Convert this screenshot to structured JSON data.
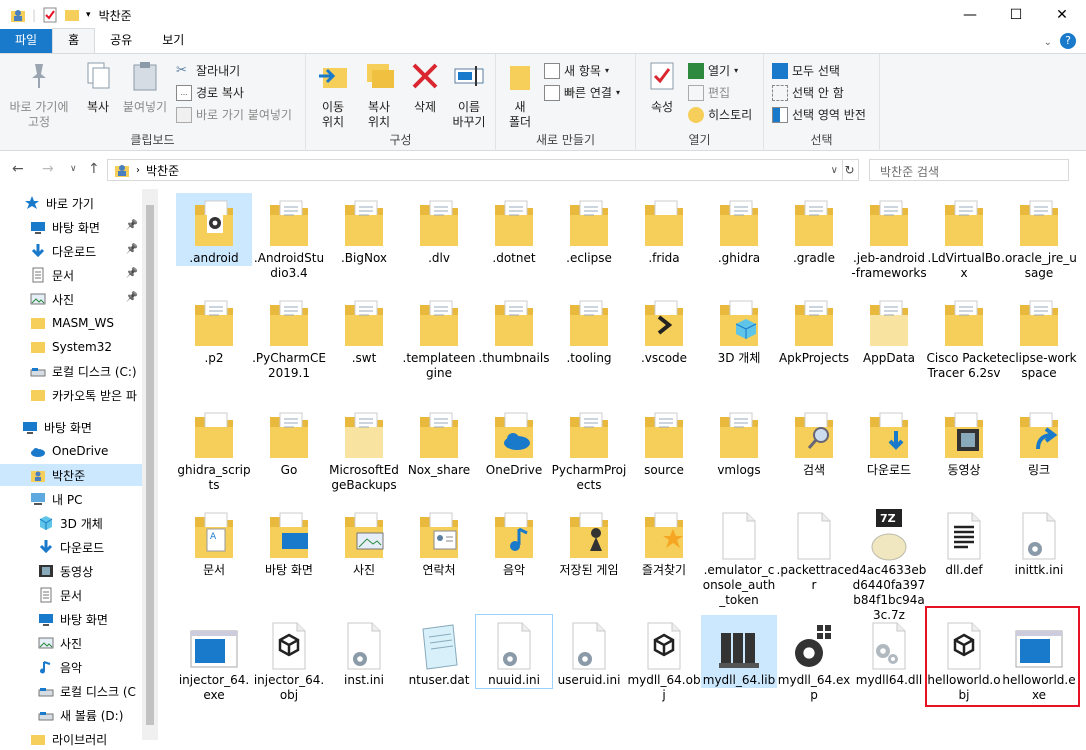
{
  "window": {
    "title": "박찬준",
    "minimize_glyph": "—",
    "maximize_glyph": "☐",
    "close_glyph": "✕"
  },
  "ribbon_tabs": [
    "파일",
    "홈",
    "공유",
    "보기"
  ],
  "ribbon": {
    "clipboard": {
      "label": "클립보드",
      "pin": "바로 가기에\n고정",
      "copy": "복사",
      "paste": "붙여넣기",
      "cut": "잘라내기",
      "copy_path": "경로 복사",
      "paste_shortcut": "바로 가기 붙여넣기"
    },
    "organize": {
      "label": "구성",
      "move_to": "이동\n위치",
      "copy_to": "복사\n위치",
      "delete": "삭제",
      "rename": "이름\n바꾸기"
    },
    "new": {
      "label": "새로 만들기",
      "new_folder": "새\n폴더",
      "new_item": "새 항목",
      "easy_access": "빠른 연결"
    },
    "open": {
      "label": "열기",
      "properties": "속성",
      "open": "열기",
      "edit": "편집",
      "history": "히스토리"
    },
    "select": {
      "label": "선택",
      "select_all": "모두 선택",
      "select_none": "선택 안 함",
      "invert": "선택 영역 반전"
    }
  },
  "address": {
    "path": "박찬준",
    "search_placeholder": "박찬준 검색"
  },
  "nav_pane": [
    {
      "label": "바로 가기",
      "icon": "star-icon",
      "pinned": false
    },
    {
      "label": "바탕 화면",
      "icon": "desktop-icon",
      "pinned": true
    },
    {
      "label": "다운로드",
      "icon": "download-icon",
      "pinned": true
    },
    {
      "label": "문서",
      "icon": "document-icon",
      "pinned": true
    },
    {
      "label": "사진",
      "icon": "picture-icon",
      "pinned": true
    },
    {
      "label": "MASM_WS",
      "icon": "folder-icon",
      "pinned": false
    },
    {
      "label": "System32",
      "icon": "folder-icon",
      "pinned": false
    },
    {
      "label": "로컬 디스크 (C:)",
      "icon": "drive-icon",
      "pinned": false
    },
    {
      "label": "카카오톡 받은 파",
      "icon": "folder-icon",
      "pinned": false
    },
    {
      "label": "바탕 화면",
      "icon": "desktop-icon",
      "pinned": false
    },
    {
      "label": "OneDrive",
      "icon": "cloud-icon",
      "pinned": false
    },
    {
      "label": "박찬준",
      "icon": "user-icon",
      "pinned": false
    },
    {
      "label": "내 PC",
      "icon": "pc-icon",
      "pinned": false
    },
    {
      "label": "3D 개체",
      "icon": "cube-icon",
      "pinned": false
    },
    {
      "label": "다운로드",
      "icon": "download-icon",
      "pinned": false
    },
    {
      "label": "동영상",
      "icon": "video-icon",
      "pinned": false
    },
    {
      "label": "문서",
      "icon": "document-icon",
      "pinned": false
    },
    {
      "label": "바탕 화면",
      "icon": "desktop-icon",
      "pinned": false
    },
    {
      "label": "사진",
      "icon": "picture-icon",
      "pinned": false
    },
    {
      "label": "음악",
      "icon": "music-icon",
      "pinned": false
    },
    {
      "label": "로컬 디스크 (C",
      "icon": "drive-icon",
      "pinned": false
    },
    {
      "label": "새 볼륨 (D:)",
      "icon": "drive-icon",
      "pinned": false
    },
    {
      "label": "라이브러리",
      "icon": "library-icon",
      "pinned": false
    }
  ],
  "files": [
    {
      "name": ".android",
      "type": "folder-gear"
    },
    {
      "name": ".AndroidStudio3.4",
      "type": "folder-doc"
    },
    {
      "name": ".BigNox",
      "type": "folder-doc"
    },
    {
      "name": ".dlv",
      "type": "folder-doc"
    },
    {
      "name": ".dotnet",
      "type": "folder-doc"
    },
    {
      "name": ".eclipse",
      "type": "folder-doc"
    },
    {
      "name": ".frida",
      "type": "folder"
    },
    {
      "name": ".ghidra",
      "type": "folder-doc"
    },
    {
      "name": ".gradle",
      "type": "folder-doc"
    },
    {
      "name": ".jeb-android-frameworks",
      "type": "folder-doc"
    },
    {
      "name": ".LdVirtualBox",
      "type": "folder-doc"
    },
    {
      "name": ".oracle_jre_usage",
      "type": "folder-doc"
    },
    {
      "name": ".p2",
      "type": "folder-doc"
    },
    {
      "name": ".PyCharmCE2019.1",
      "type": "folder-doc"
    },
    {
      "name": ".swt",
      "type": "folder-doc"
    },
    {
      "name": ".templateengine",
      "type": "folder-doc"
    },
    {
      "name": ".thumbnails",
      "type": "folder-doc"
    },
    {
      "name": ".tooling",
      "type": "folder-doc"
    },
    {
      "name": ".vscode",
      "type": "folder-vscode"
    },
    {
      "name": "3D 개체",
      "type": "folder-3d"
    },
    {
      "name": "ApkProjects",
      "type": "folder-doc"
    },
    {
      "name": "AppData",
      "type": "folder-light"
    },
    {
      "name": "Cisco Packet Tracer 6.2sv",
      "type": "folder-doc"
    },
    {
      "name": "eclipse-workspace",
      "type": "folder-doc"
    },
    {
      "name": "ghidra_scripts",
      "type": "folder"
    },
    {
      "name": "Go",
      "type": "folder-doc"
    },
    {
      "name": "MicrosoftEdgeBackups",
      "type": "folder-light"
    },
    {
      "name": "Nox_share",
      "type": "folder-doc"
    },
    {
      "name": "OneDrive",
      "type": "folder-onedrive"
    },
    {
      "name": "PycharmProjects",
      "type": "folder-doc"
    },
    {
      "name": "source",
      "type": "folder-doc"
    },
    {
      "name": "vmlogs",
      "type": "folder-doc"
    },
    {
      "name": "검색",
      "type": "folder-search"
    },
    {
      "name": "다운로드",
      "type": "folder-download"
    },
    {
      "name": "동영상",
      "type": "folder-video"
    },
    {
      "name": "링크",
      "type": "folder-link"
    },
    {
      "name": "문서",
      "type": "folder-documents"
    },
    {
      "name": "바탕 화면",
      "type": "folder-desktop"
    },
    {
      "name": "사진",
      "type": "folder-pictures"
    },
    {
      "name": "연락처",
      "type": "folder-contacts"
    },
    {
      "name": "음악",
      "type": "folder-music"
    },
    {
      "name": "저장된 게임",
      "type": "folder-games"
    },
    {
      "name": "즐겨찾기",
      "type": "folder-favorites"
    },
    {
      "name": ".emulator_console_auth_token",
      "type": "file-blank"
    },
    {
      "name": ".packettracer",
      "type": "file-blank"
    },
    {
      "name": "d4ac4633ebd6440fa397b84f1bc94a3c.7z",
      "type": "file-7z"
    },
    {
      "name": "dll.def",
      "type": "file-text"
    },
    {
      "name": "inittk.ini",
      "type": "file-ini"
    },
    {
      "name": "injector_64.exe",
      "type": "file-exe"
    },
    {
      "name": "injector_64.obj",
      "type": "file-obj"
    },
    {
      "name": "inst.ini",
      "type": "file-ini"
    },
    {
      "name": "ntuser.dat",
      "type": "file-notepad"
    },
    {
      "name": "nuuid.ini",
      "type": "file-ini"
    },
    {
      "name": "useruid.ini",
      "type": "file-ini"
    },
    {
      "name": "mydll_64.obj",
      "type": "file-obj"
    },
    {
      "name": "mydll_64.lib",
      "type": "file-lib"
    },
    {
      "name": "mydll_64.exp",
      "type": "file-exp"
    },
    {
      "name": "mydll64.dll",
      "type": "file-dll"
    },
    {
      "name": "helloworld.obj",
      "type": "file-obj"
    },
    {
      "name": "helloworld.exe",
      "type": "file-exe"
    }
  ],
  "colors": {
    "folder": "#f5cf5a",
    "folder_back": "#e8b93c",
    "selection": "#cce8ff",
    "file_tab": "#1979ca",
    "highlight_box": "#e81123"
  }
}
